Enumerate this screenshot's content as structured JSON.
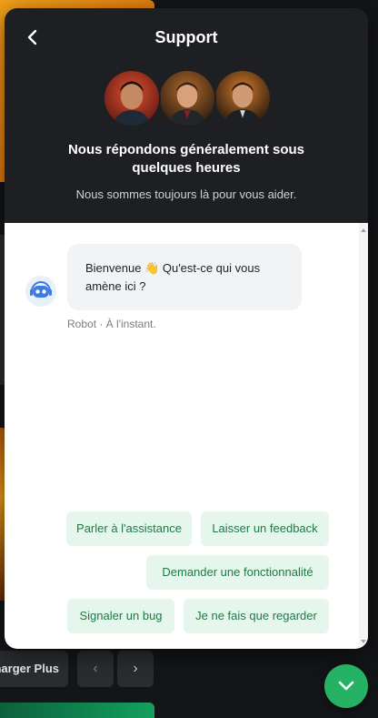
{
  "header": {
    "title": "Support",
    "headline": "Nous répondons généralement sous quelques heures",
    "subtitle": "Nous sommes toujours là pour vous aider."
  },
  "conversation": {
    "message": "Bienvenue 👋 Qu'est-ce qui vous amène ici ?",
    "meta": "Robot · À l'instant."
  },
  "quick_replies": [
    "Parler à l'assistance",
    "Laisser un feedback",
    "Demander une fonctionnalité",
    "Signaler un bug",
    "Je ne fais que regarder"
  ],
  "background": {
    "load_more_label": "harger Plus",
    "prev_arrow": "‹",
    "next_arrow": "›"
  },
  "colors": {
    "accent": "#25b265",
    "quick_reply_bg": "#e6f6ec",
    "quick_reply_text": "#1f7a45",
    "header_bg": "#1d1f22"
  },
  "icons": {
    "back": "chevron-left-icon",
    "bot": "robot-icon",
    "launcher": "chevron-down-icon"
  }
}
